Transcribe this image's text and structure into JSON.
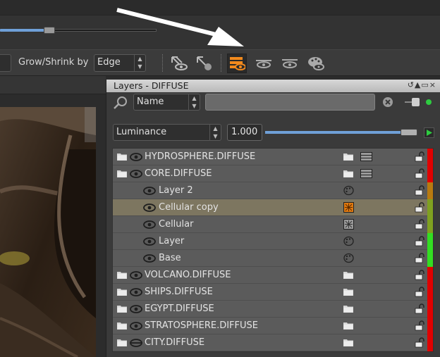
{
  "toolbar": {
    "grow_shrink_label": "Grow/Shrink by",
    "grow_shrink_value": "Edge"
  },
  "panel": {
    "title": "Layers - DIFFUSE",
    "window_buttons": "↺▲▭×"
  },
  "filter": {
    "field_value": "Name",
    "input_value": ""
  },
  "blend": {
    "mode": "Luminance",
    "opacity": "1.000",
    "opacity_fraction": 0.88
  },
  "colors": {
    "accent": "#6fa0d8",
    "active_icon": "#f28a1d",
    "status_green": "#2ecc40",
    "bar_red": "#e00000",
    "bar_olive": "#7fa020",
    "bar_orange": "#b87a10",
    "bar_green": "#33dd22"
  },
  "layers": [
    {
      "name": "HYDROSPHERE.DIFFUSE",
      "group": true,
      "indent": 0,
      "eye": true,
      "bar": "#e00000"
    },
    {
      "name": "CORE.DIFFUSE",
      "group": true,
      "indent": 0,
      "eye": true,
      "open": true,
      "bar": "#e00000"
    },
    {
      "name": "Layer 2",
      "group": false,
      "indent": 1,
      "eye": true,
      "type": "paint",
      "bar": "#b87a10"
    },
    {
      "name": "Cellular copy",
      "group": false,
      "indent": 1,
      "eye": true,
      "type": "procedural-orange",
      "selected": true,
      "bar": "#7fa020"
    },
    {
      "name": "Cellular",
      "group": false,
      "indent": 1,
      "eye": true,
      "type": "procedural",
      "bar": "#7fa020"
    },
    {
      "name": "Layer",
      "group": false,
      "indent": 1,
      "eye": true,
      "type": "paint",
      "bar": "#33dd22"
    },
    {
      "name": "Base",
      "group": false,
      "indent": 1,
      "eye": true,
      "type": "paint",
      "bar": "#33dd22"
    },
    {
      "name": "VOLCANO.DIFFUSE",
      "group": true,
      "indent": 0,
      "eye": true,
      "bar": "#e00000"
    },
    {
      "name": "SHIPS.DIFFUSE",
      "group": true,
      "indent": 0,
      "eye": true,
      "bar": "#e00000"
    },
    {
      "name": "EGYPT.DIFFUSE",
      "group": true,
      "indent": 0,
      "eye": true,
      "bar": "#e00000"
    },
    {
      "name": "STRATOSPHERE.DIFFUSE",
      "group": true,
      "indent": 0,
      "eye": true,
      "bar": "#e00000"
    },
    {
      "name": "CITY.DIFFUSE",
      "group": true,
      "indent": 0,
      "eye": false,
      "bar": "#e00000"
    }
  ],
  "icons": [
    "arrow-eye-icon",
    "arrow-dot-icon",
    "layers-eye-icon",
    "eye-strike-icon",
    "eye-bar-icon",
    "palette-eye-icon"
  ]
}
